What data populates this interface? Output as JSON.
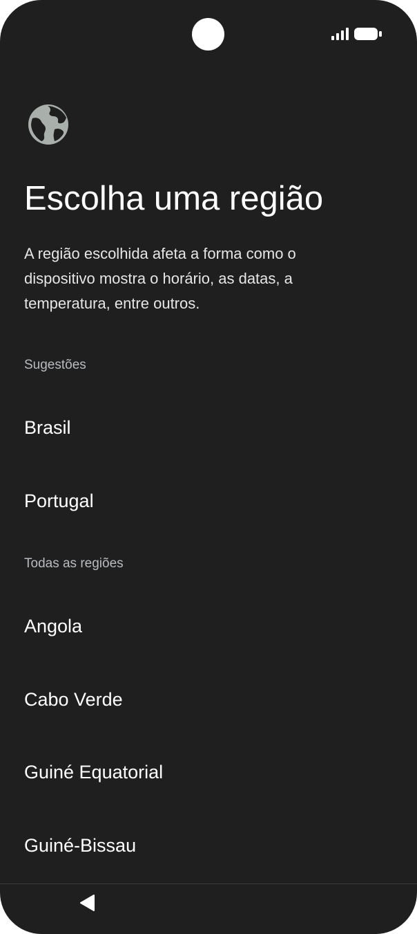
{
  "header": {
    "title": "Escolha uma região",
    "description": "A região escolhida afeta a forma como o dispositivo mostra o horário, as datas, a temperatura, entre outros."
  },
  "icons": {
    "header_icon": "globe-icon",
    "signal": "cellular-signal-icon",
    "battery": "battery-icon",
    "back": "back-triangle-icon"
  },
  "suggestions": {
    "header": "Sugestões",
    "items": [
      {
        "label": "Brasil"
      },
      {
        "label": "Portugal"
      }
    ]
  },
  "all_regions": {
    "header": "Todas as regiões",
    "items": [
      {
        "label": "Angola"
      },
      {
        "label": "Cabo Verde"
      },
      {
        "label": "Guiné Equatorial"
      },
      {
        "label": "Guiné-Bissau"
      }
    ]
  },
  "colors": {
    "background": "#1f1f1f",
    "text_primary": "#ffffff",
    "text_secondary": "#b8bcc0",
    "icon_globe": "#a9b0ac"
  }
}
